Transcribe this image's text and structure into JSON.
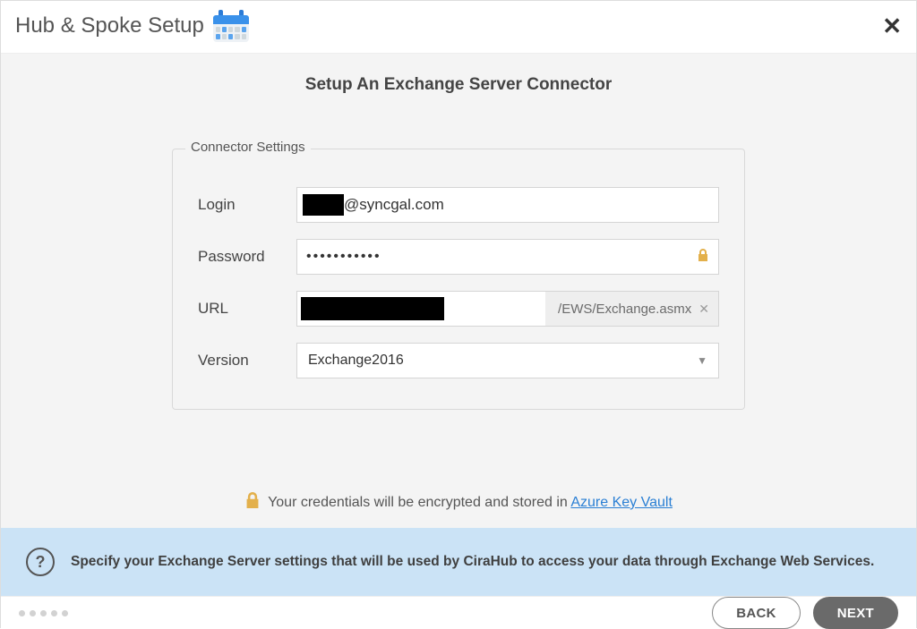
{
  "header": {
    "title": "Hub & Spoke Setup"
  },
  "page_title": "Setup An Exchange Server Connector",
  "fieldset_legend": "Connector Settings",
  "form": {
    "login_label": "Login",
    "login_suffix": "@syncgal.com",
    "password_label": "Password",
    "password_masked": "•••••••••••",
    "url_label": "URL",
    "url_suffix": "/EWS/Exchange.asmx",
    "version_label": "Version",
    "version_value": "Exchange2016"
  },
  "credentials_note": {
    "prefix": "Your credentials will be encrypted and stored in ",
    "link_text": "Azure Key Vault"
  },
  "info_text": "Specify your Exchange Server settings that will be used by CiraHub to access your data through Exchange Web Services.",
  "footer": {
    "back_label": "BACK",
    "next_label": "NEXT"
  }
}
